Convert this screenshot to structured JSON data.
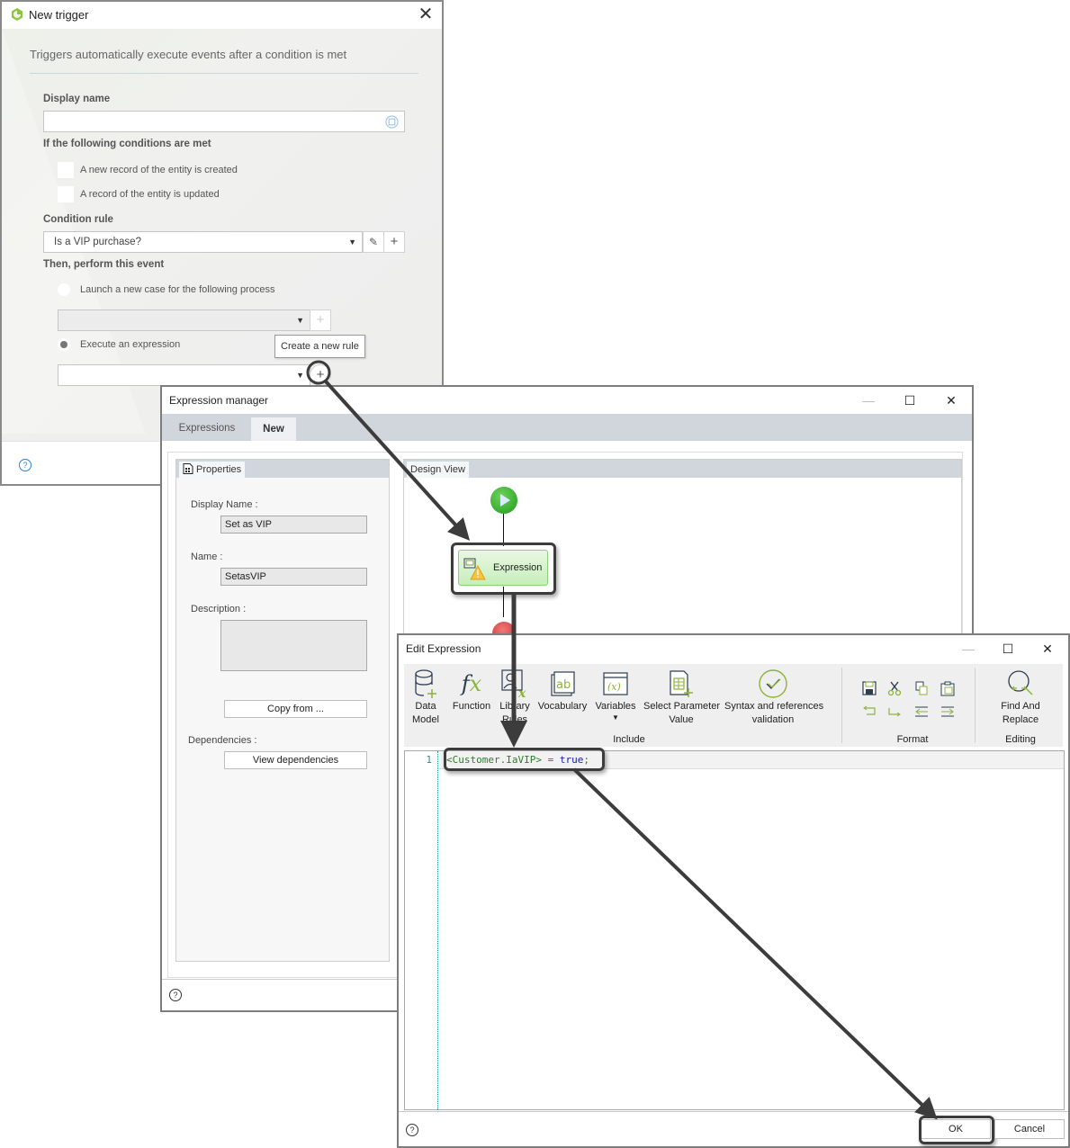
{
  "new_trigger": {
    "title": "New trigger",
    "subtitle": "Triggers automatically execute events after a condition is met",
    "display_name_label": "Display name",
    "display_name_value": "",
    "conditions_label": "If the following conditions are met",
    "conditions": [
      {
        "label": "A new record of the entity is created",
        "checked": false
      },
      {
        "label": "A record of the entity is updated",
        "checked": false
      }
    ],
    "condition_rule_label": "Condition rule",
    "condition_rule_value": "Is a VIP purchase?",
    "event_label": "Then, perform this event",
    "events": [
      {
        "label": "Launch a new case for the following process",
        "selected": false
      },
      {
        "label": "Execute an expression",
        "selected": true
      }
    ],
    "process_value": "",
    "expression_value": "",
    "tooltip": "Create a new rule",
    "help_icon": "?"
  },
  "expression_manager": {
    "title": "Expression manager",
    "tabs": [
      {
        "label": "Expressions",
        "active": false
      },
      {
        "label": "New",
        "active": true
      }
    ],
    "properties": {
      "tab_label": "Properties",
      "display_name_label": "Display Name :",
      "display_name_value": "Set as VIP",
      "name_label": "Name :",
      "name_value": "SetasVIP",
      "description_label": "Description :",
      "description_value": "",
      "copy_from_button": "Copy from ...",
      "dependencies_label": "Dependencies :",
      "view_dependencies_button": "View dependencies"
    },
    "design_view": {
      "tab_label": "Design View",
      "expression_node_label": "Expression"
    },
    "help_icon": "?"
  },
  "edit_expression": {
    "title": "Edit Expression",
    "ribbon": {
      "include_group": "Include",
      "format_group": "Format",
      "editing_group": "Editing",
      "buttons": {
        "data_model": "Data\nModel",
        "function": "Function",
        "library_rules": "Library\nRules",
        "vocabulary": "Vocabulary",
        "variables": "Variables",
        "select_parameter_value": "Select Parameter\nValue",
        "syntax_validation": "Syntax and references\nvalidation",
        "find_replace": "Find And\nReplace"
      }
    },
    "editor": {
      "line_number": "1",
      "code_ref": "<Customer.IaVIP>",
      "code_op": " = ",
      "code_kw": "true",
      "code_end": ";"
    },
    "ok_button": "OK",
    "cancel_button": "Cancel",
    "help_icon": "?"
  },
  "colors": {
    "accent_green": "#8cb33a",
    "icon_navy": "#2d3e50",
    "highlight_border": "#3c3c3c"
  }
}
